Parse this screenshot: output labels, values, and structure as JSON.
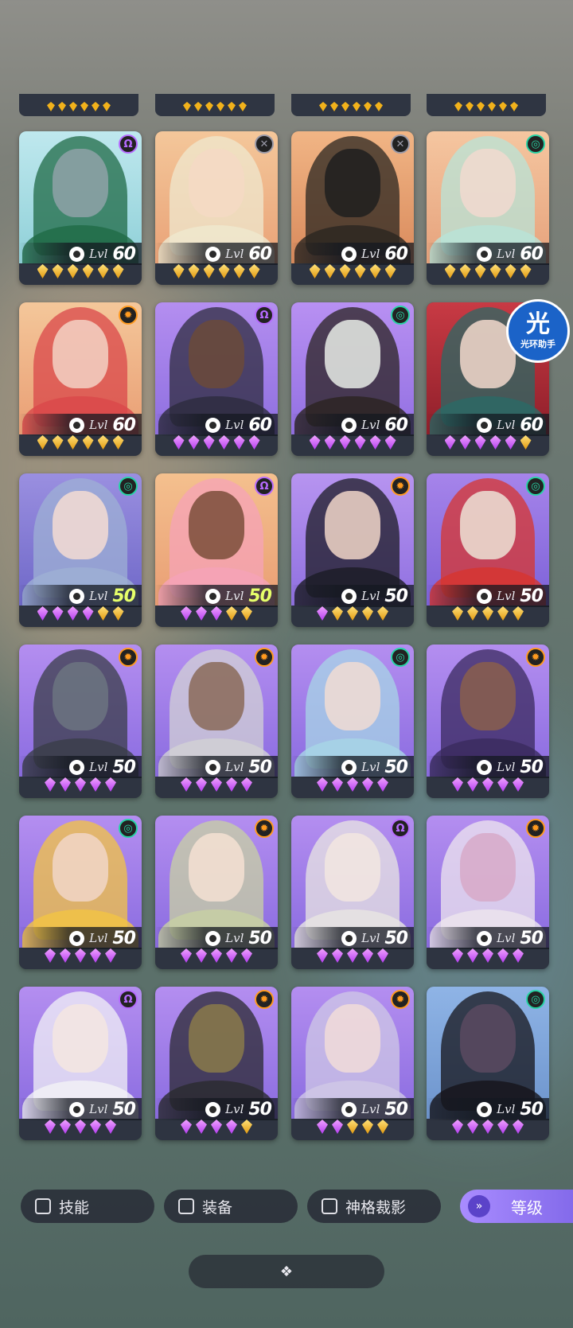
{
  "level_label": "Lvl",
  "badge": {
    "big": "光",
    "small": "光环助手"
  },
  "filters": [
    {
      "label": "技能"
    },
    {
      "label": "装备"
    },
    {
      "label": "神格裁影"
    }
  ],
  "sort": {
    "label": "等级",
    "icon": "double-chevron-down-icon"
  },
  "collapse_icon": "diamond-cluster-icon",
  "factions": {
    "omega": {
      "glyph": "Ω",
      "color": "#b66bff"
    },
    "cross": {
      "glyph": "✕",
      "color": "#9a9aa8"
    },
    "swirl": {
      "glyph": "◎",
      "color": "#27d3a4"
    },
    "sun": {
      "glyph": "✹",
      "color": "#ff9a1f"
    }
  },
  "cards": [
    {
      "level": 60,
      "faction": "omega",
      "gems": [
        "gold",
        "gold",
        "gold",
        "gold",
        "gold",
        "gold"
      ],
      "bg": [
        "#bfe8ee",
        "#8fd0d8"
      ],
      "hair": "#1f6a46",
      "skin": "#8fa2a8"
    },
    {
      "level": 60,
      "faction": "cross",
      "gems": [
        "gold",
        "gold",
        "gold",
        "gold",
        "gold",
        "gold"
      ],
      "bg": [
        "#f4c79a",
        "#e9a277"
      ],
      "hair": "#efe8cf",
      "skin": "#f5d9c4"
    },
    {
      "level": 60,
      "faction": "cross",
      "gems": [
        "gold",
        "gold",
        "gold",
        "gold",
        "gold",
        "gold"
      ],
      "bg": [
        "#f1b585",
        "#d98a5c"
      ],
      "hair": "#2a2620",
      "skin": "#1e1e1e"
    },
    {
      "level": 60,
      "faction": "swirl",
      "gems": [
        "gold",
        "gold",
        "gold",
        "gold",
        "gold",
        "gold"
      ],
      "bg": [
        "#f5c6a0",
        "#e6a27c"
      ],
      "hair": "#b8e4d8",
      "skin": "#f1d9cf"
    },
    {
      "level": 60,
      "faction": "sun",
      "gems": [
        "gold",
        "gold",
        "gold",
        "gold",
        "gold",
        "gold"
      ],
      "bg": [
        "#f4c79a",
        "#e99e74"
      ],
      "hair": "#d9474a",
      "skin": "#f3d2c4"
    },
    {
      "level": 60,
      "faction": "omega",
      "gems": [
        "purple",
        "purple",
        "purple",
        "purple",
        "purple",
        "purple"
      ],
      "bg": [
        "#b48ef0",
        "#8e6fe0"
      ],
      "hair": "#2d2c3e",
      "skin": "#6b4a3a"
    },
    {
      "level": 60,
      "faction": "swirl",
      "gems": [
        "purple",
        "purple",
        "purple",
        "purple",
        "purple",
        "purple"
      ],
      "bg": [
        "#b890f2",
        "#9270e2"
      ],
      "hair": "#2a2320",
      "skin": "#e8ece6"
    },
    {
      "level": 60,
      "faction": "swirl",
      "gems": [
        "purple",
        "purple",
        "purple",
        "purple",
        "purple",
        "gold"
      ],
      "bg": [
        "#c83a44",
        "#8f1f2a"
      ],
      "hair": "#2a6a66",
      "skin": "#f3d9cc"
    },
    {
      "level": 50,
      "level_hi": true,
      "faction": "swirl",
      "gems": [
        "purple",
        "purple",
        "purple",
        "purple",
        "gold",
        "gold"
      ],
      "bg": [
        "#9a8fe0",
        "#6f68c8"
      ],
      "hair": "#9db0d4",
      "skin": "#f4dcd2"
    },
    {
      "level": 50,
      "level_hi": true,
      "faction": "omega",
      "gems": [
        "purple",
        "purple",
        "purple",
        "gold",
        "gold"
      ],
      "bg": [
        "#f4c08e",
        "#e99e74"
      ],
      "hair": "#f5a3b8",
      "skin": "#7a4e3a"
    },
    {
      "level": 50,
      "faction": "sun",
      "gems": [
        "purple",
        "gold",
        "gold",
        "gold",
        "gold"
      ],
      "bg": [
        "#b794f0",
        "#8f70e0"
      ],
      "hair": "#1c1c24",
      "skin": "#f1d6c8"
    },
    {
      "level": 50,
      "faction": "swirl",
      "gems": [
        "gold",
        "gold",
        "gold",
        "gold",
        "gold"
      ],
      "bg": [
        "#a684ea",
        "#7d62d8"
      ],
      "hair": "#d7352e",
      "skin": "#ece3d6"
    },
    {
      "level": 50,
      "faction": "sun",
      "gems": [
        "purple",
        "purple",
        "purple",
        "purple",
        "purple"
      ],
      "bg": [
        "#b48ef0",
        "#8a6ce0"
      ],
      "hair": "#3a3d48",
      "skin": "#6c7480"
    },
    {
      "level": 50,
      "faction": "sun",
      "gems": [
        "purple",
        "purple",
        "purple",
        "purple",
        "purple"
      ],
      "bg": [
        "#b48ef0",
        "#8a6ce0"
      ],
      "hair": "#d2d2d4",
      "skin": "#8a6a58"
    },
    {
      "level": 50,
      "faction": "swirl",
      "gems": [
        "purple",
        "purple",
        "purple",
        "purple",
        "purple"
      ],
      "bg": [
        "#b48ef0",
        "#8a6ce0"
      ],
      "hair": "#a7d6e6",
      "skin": "#f1dcd2"
    },
    {
      "level": 50,
      "faction": "sun",
      "gems": [
        "purple",
        "purple",
        "purple",
        "purple",
        "purple"
      ],
      "bg": [
        "#b48ef0",
        "#8a6ce0"
      ],
      "hair": "#3a2a5e",
      "skin": "#8a5f4c"
    },
    {
      "level": 50,
      "faction": "swirl",
      "gems": [
        "purple",
        "purple",
        "purple",
        "purple",
        "purple"
      ],
      "bg": [
        "#b48ef0",
        "#8a6ce0"
      ],
      "hair": "#f3c443",
      "skin": "#f1d6c8"
    },
    {
      "level": 50,
      "faction": "sun",
      "gems": [
        "purple",
        "purple",
        "purple",
        "purple",
        "purple"
      ],
      "bg": [
        "#b48ef0",
        "#8a6ce0"
      ],
      "hair": "#c8d1a2",
      "skin": "#f4e0d2"
    },
    {
      "level": 50,
      "faction": "omega",
      "gems": [
        "purple",
        "purple",
        "purple",
        "purple",
        "purple"
      ],
      "bg": [
        "#b48ef0",
        "#8a6ce0"
      ],
      "hair": "#e8e6e2",
      "skin": "#f2e6e0"
    },
    {
      "level": 50,
      "faction": "sun",
      "gems": [
        "purple",
        "purple",
        "purple",
        "purple",
        "purple"
      ],
      "bg": [
        "#b48ef0",
        "#8a6ce0"
      ],
      "hair": "#eee6ee",
      "skin": "#d7a9c8"
    },
    {
      "level": 50,
      "faction": "omega",
      "gems": [
        "purple",
        "purple",
        "purple",
        "purple",
        "purple"
      ],
      "bg": [
        "#b48ef0",
        "#8a6ce0"
      ],
      "hair": "#f2f2f6",
      "skin": "#f5e6e0"
    },
    {
      "level": 50,
      "faction": "sun",
      "gems": [
        "purple",
        "purple",
        "purple",
        "purple",
        "gold"
      ],
      "bg": [
        "#b48ef0",
        "#8a6ce0"
      ],
      "hair": "#2a2a30",
      "skin": "#8a7a4a"
    },
    {
      "level": 50,
      "faction": "sun",
      "gems": [
        "purple",
        "purple",
        "gold",
        "gold",
        "gold"
      ],
      "bg": [
        "#b48ef0",
        "#8a6ce0"
      ],
      "hair": "#cfc8e6",
      "skin": "#f1dcd8"
    },
    {
      "level": 50,
      "faction": "swirl",
      "gems": [
        "purple",
        "purple",
        "purple",
        "purple",
        "purple"
      ],
      "bg": [
        "#8fb4e6",
        "#6d94cc"
      ],
      "hair": "#15141a",
      "skin": "#5a4a60"
    }
  ]
}
